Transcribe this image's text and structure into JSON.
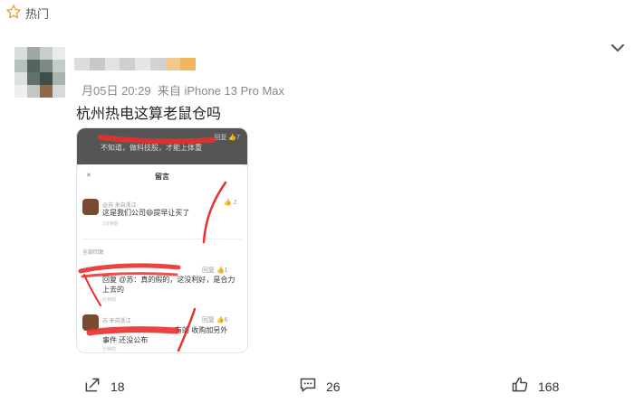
{
  "header": {
    "hot_label": "热门",
    "hot_icon": "star-icon"
  },
  "post": {
    "timestamp": "月05日 20:29",
    "source": "来自 iPhone 13 Pro Max",
    "caption": "杭州热电这算老鼠仓吗"
  },
  "screenshot": {
    "top_text": "不知道，做科技股，才能上体重",
    "top_meta": "回复 👍7",
    "sheet_title": "留言",
    "close_icon": "close-icon",
    "comment1": {
      "name": "@苏 来自浙江",
      "text": "这是我们公司😄提早让买了",
      "time": "1分钟前",
      "likes": "2"
    },
    "section": "全部回复",
    "reply1": {
      "action": "回复 👍1",
      "text": "回复 @苏：真的假的，这没利好，是合力上去的",
      "time": "分钟前"
    },
    "reply2": {
      "name": "苏 来自浙江",
      "action": "回复 👍6",
      "text_a": "有的 收购加另外",
      "text_b": "事件 还没公布",
      "time": "分钟前"
    }
  },
  "actions": {
    "share_count": "18",
    "comment_count": "26",
    "like_count": "168"
  }
}
